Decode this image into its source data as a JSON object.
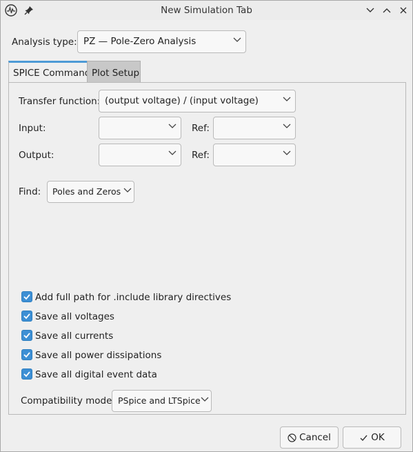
{
  "window": {
    "title": "New Simulation Tab"
  },
  "analysis": {
    "label": "Analysis type:",
    "value": "PZ  —  Pole-Zero Analysis"
  },
  "tabs": [
    {
      "label": "SPICE Command",
      "active": true
    },
    {
      "label": "Plot Setup",
      "active": false
    }
  ],
  "spice": {
    "transfer_label": "Transfer function:",
    "transfer_value": "(output voltage) / (input voltage)",
    "input_label": "Input:",
    "input_value": "",
    "input_ref_label": "Ref:",
    "input_ref_value": "",
    "output_label": "Output:",
    "output_value": "",
    "output_ref_label": "Ref:",
    "output_ref_value": "",
    "find_label": "Find:",
    "find_value": "Poles and Zeros"
  },
  "options": [
    {
      "label": "Add full path for .include library directives",
      "checked": true
    },
    {
      "label": "Save all voltages",
      "checked": true
    },
    {
      "label": "Save all currents",
      "checked": true
    },
    {
      "label": "Save all power dissipations",
      "checked": true
    },
    {
      "label": "Save all digital event data",
      "checked": true
    }
  ],
  "compat": {
    "label": "Compatibility mode:",
    "value": "PSpice and LTSpice"
  },
  "buttons": {
    "cancel": "Cancel",
    "ok": "OK"
  },
  "colors": {
    "accent": "#3d8fd4",
    "tab_active_border": "#4d9ad6"
  }
}
